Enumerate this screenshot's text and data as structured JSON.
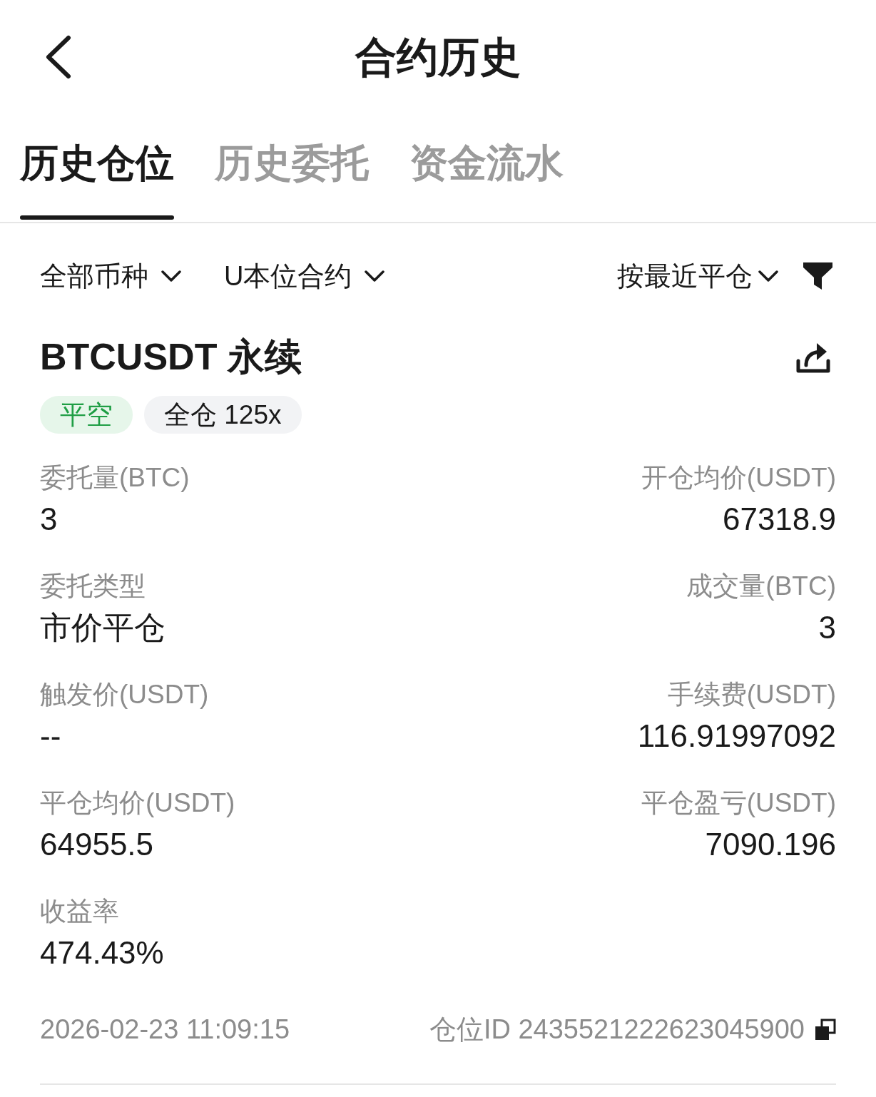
{
  "header": {
    "title": "合约历史"
  },
  "tabs": [
    {
      "label": "历史仓位",
      "selected": true
    },
    {
      "label": "历史委托",
      "selected": false
    },
    {
      "label": "资金流水",
      "selected": false
    }
  ],
  "filters": [
    {
      "label": "全部币种"
    },
    {
      "label": "U本位合约"
    }
  ],
  "sort": {
    "label": "按最近平仓"
  },
  "position": {
    "symbol": "BTCUSDT 永续",
    "tags": [
      {
        "label": "平空",
        "kind": "side"
      },
      {
        "label": "全仓 125x",
        "kind": "mode"
      }
    ],
    "fields": [
      {
        "label": "委托量(BTC)",
        "value": "3"
      },
      {
        "label": "开仓均价(USDT)",
        "value": "67318.9"
      },
      {
        "label": "委托类型",
        "value": "市价平仓"
      },
      {
        "label": "成交量(BTC)",
        "value": "3"
      },
      {
        "label": "触发价(USDT)",
        "value": "--"
      },
      {
        "label": "手续费(USDT)",
        "value": "116.91997092"
      },
      {
        "label": "平仓均价(USDT)",
        "value": "64955.5"
      },
      {
        "label": "平仓盈亏(USDT)",
        "value": "7090.196"
      },
      {
        "label": "收益率",
        "value": "474.43%"
      }
    ],
    "timestamp": "2026-02-23 11:09:15",
    "position_id": "仓位ID 2435521222623045900"
  }
}
